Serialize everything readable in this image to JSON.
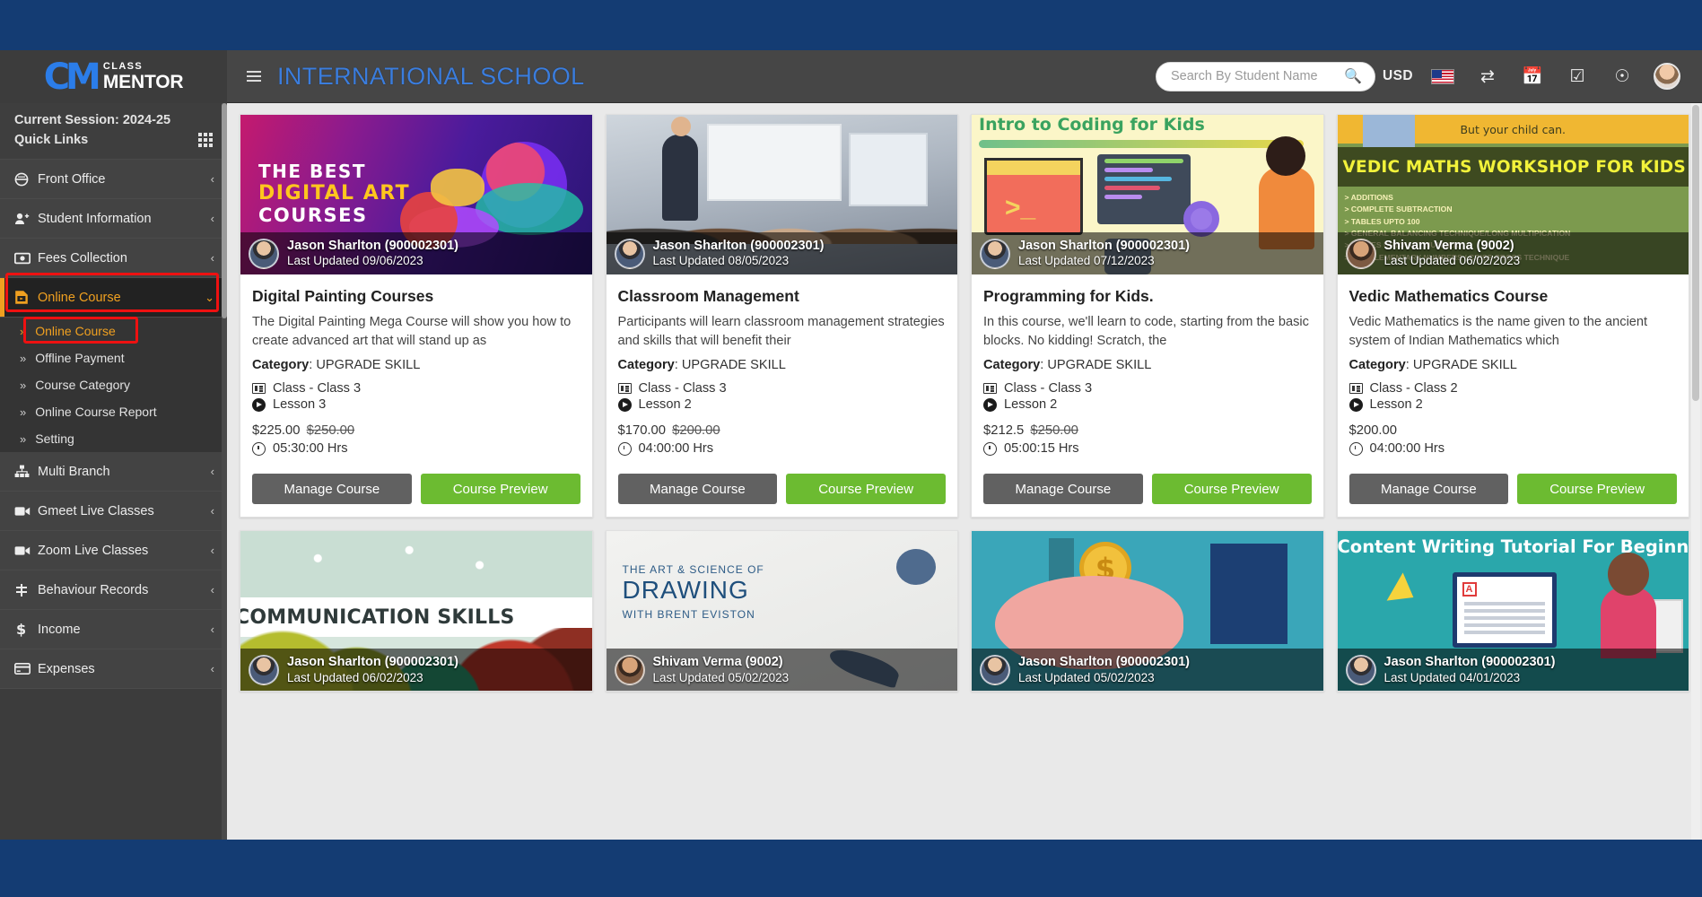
{
  "brand": {
    "word1": "CLASS",
    "word2": "MENTOR",
    "mark": "CM"
  },
  "sidebar": {
    "session_label": "Current Session: 2024-25",
    "quick_links_label": "Quick Links",
    "items": [
      {
        "label": "Front Office",
        "icon": "front-office-icon",
        "caret": "‹"
      },
      {
        "label": "Student Information",
        "icon": "student-icon",
        "caret": "‹"
      },
      {
        "label": "Fees Collection",
        "icon": "fees-icon",
        "caret": "‹"
      },
      {
        "label": "Online Course",
        "icon": "online-course-icon",
        "caret": "‹",
        "active": true
      }
    ],
    "submenu": [
      {
        "label": "Online Course",
        "active": true
      },
      {
        "label": "Offline Payment",
        "active": false
      },
      {
        "label": "Course Category",
        "active": false
      },
      {
        "label": "Online Course Report",
        "active": false
      },
      {
        "label": "Setting",
        "active": false
      }
    ],
    "items_after": [
      {
        "label": "Multi Branch",
        "icon": "multi-branch-icon",
        "caret": "‹"
      },
      {
        "label": "Gmeet Live Classes",
        "icon": "video-camera-icon",
        "caret": "‹"
      },
      {
        "label": "Zoom Live Classes",
        "icon": "video-camera-icon",
        "caret": "‹"
      },
      {
        "label": "Behaviour Records",
        "icon": "behaviour-icon",
        "caret": "‹"
      },
      {
        "label": "Income",
        "icon": "dollar-icon",
        "caret": "‹"
      },
      {
        "label": "Expenses",
        "icon": "card-icon",
        "caret": "‹"
      }
    ]
  },
  "topbar": {
    "menu_toggle": "hamburger-icon",
    "title": "INTERNATIONAL SCHOOL",
    "search": {
      "value": "",
      "placeholder": "Search By Student Name"
    },
    "currency": "USD",
    "icons": [
      "us-flag-icon",
      "transfer-icon",
      "calendar-icon",
      "checkbox-icon",
      "whatsapp-icon",
      "profile-avatar"
    ]
  },
  "colors": {
    "page_bg": "#143c73",
    "sidebar_bg": "#3c3c3c",
    "topbar_bg": "#464646",
    "accent_orange": "#f0a020",
    "title_blue": "#3b7ddd",
    "btn_manage": "#616161",
    "btn_preview": "#6cbb31",
    "annotation_red": "#ee1111"
  },
  "buttons": {
    "manage": "Manage Course",
    "preview": "Course Preview"
  },
  "labels": {
    "category": "Category",
    "class_prefix": "Class - "
  },
  "courses": [
    {
      "art": "art-digital",
      "banner_text": {
        "line1": "THE BEST",
        "line2": "DIGITAL ART",
        "line3": "COURSES"
      },
      "author": "Jason Sharlton (900002301)",
      "author_avatar": "av-jason",
      "updated": "Last Updated 09/06/2023",
      "title": "Digital Painting Courses",
      "desc": "The Digital Painting Mega Course will show you how to create advanced art that will stand up as",
      "category": "UPGRADE SKILL",
      "class": "Class - Class 3",
      "lesson": "Lesson 3",
      "price": "$225.00",
      "old_price": "$250.00",
      "duration": "05:30:00 Hrs"
    },
    {
      "art": "art-classroom",
      "banner_text": {},
      "author": "Jason Sharlton (900002301)",
      "author_avatar": "av-jason",
      "updated": "Last Updated 08/05/2023",
      "title": "Classroom Management",
      "desc": "Participants will learn classroom management strategies and skills that will benefit their",
      "category": "UPGRADE SKILL",
      "class": "Class - Class 3",
      "lesson": "Lesson 2",
      "price": "$170.00",
      "old_price": "$200.00",
      "duration": "04:00:00 Hrs"
    },
    {
      "art": "art-coding",
      "banner_text": {
        "line1": "Intro to Coding for Kids"
      },
      "author": "Jason Sharlton (900002301)",
      "author_avatar": "av-jason",
      "updated": "Last Updated 07/12/2023",
      "title": "Programming for Kids.",
      "desc": "In this course, we'll learn to code, starting from the basic blocks. No kidding! Scratch, the",
      "category": "UPGRADE SKILL",
      "class": "Class - Class 3",
      "lesson": "Lesson 2",
      "price": "$212.5",
      "old_price": "$250.00",
      "duration": "05:00:15 Hrs"
    },
    {
      "art": "art-vedic",
      "banner_text": {
        "top": "But your child can.",
        "line1": "VEDIC MATHS WORKSHOP FOR KIDS",
        "bullets": [
          "ADDITIONS",
          "COMPLETE SUBTRACTION",
          "TABLES UPTO 100",
          "GENERAL BALANCING TECHNIQUE/LONG MULTIPICATION",
          "TABLES UPTO ANY NUMBER",
          "COMPLEMENTARY NUMBERS / CRISS CROSS TECHNIQUE"
        ]
      },
      "author": "Shivam Verma (9002)",
      "author_avatar": "av-shivam",
      "updated": "Last Updated 06/02/2023",
      "title": "Vedic Mathematics Course",
      "desc": "Vedic Mathematics is the name given to the ancient system of Indian Mathematics which",
      "category": "UPGRADE SKILL",
      "class": "Class - Class 2",
      "lesson": "Lesson 2",
      "price": "$200.00",
      "old_price": "",
      "duration": "04:00:00 Hrs"
    }
  ],
  "courses_row2": [
    {
      "art": "art-comm",
      "banner_text": {
        "line1": "COMMUNICATION SKILLS"
      },
      "author": "Jason Sharlton (900002301)",
      "author_avatar": "av-jason",
      "updated": "Last Updated 06/02/2023"
    },
    {
      "art": "art-drawing",
      "banner_text": {
        "line1": "THE ART & SCIENCE OF",
        "line2": "DRAWING",
        "line3": "WITH BRENT EVISTON"
      },
      "author": "Shivam Verma (9002)",
      "author_avatar": "av-shivam",
      "updated": "Last Updated 05/02/2023"
    },
    {
      "art": "art-piggy",
      "banner_text": {
        "coin": "$"
      },
      "author": "Jason Sharlton (900002301)",
      "author_avatar": "av-jason",
      "updated": "Last Updated 05/02/2023"
    },
    {
      "art": "art-content",
      "banner_text": {
        "line1": "Content Writing Tutorial For Beginners",
        "letter": "A"
      },
      "author": "Jason Sharlton (900002301)",
      "author_avatar": "av-jason",
      "updated": "Last Updated 04/01/2023"
    }
  ]
}
